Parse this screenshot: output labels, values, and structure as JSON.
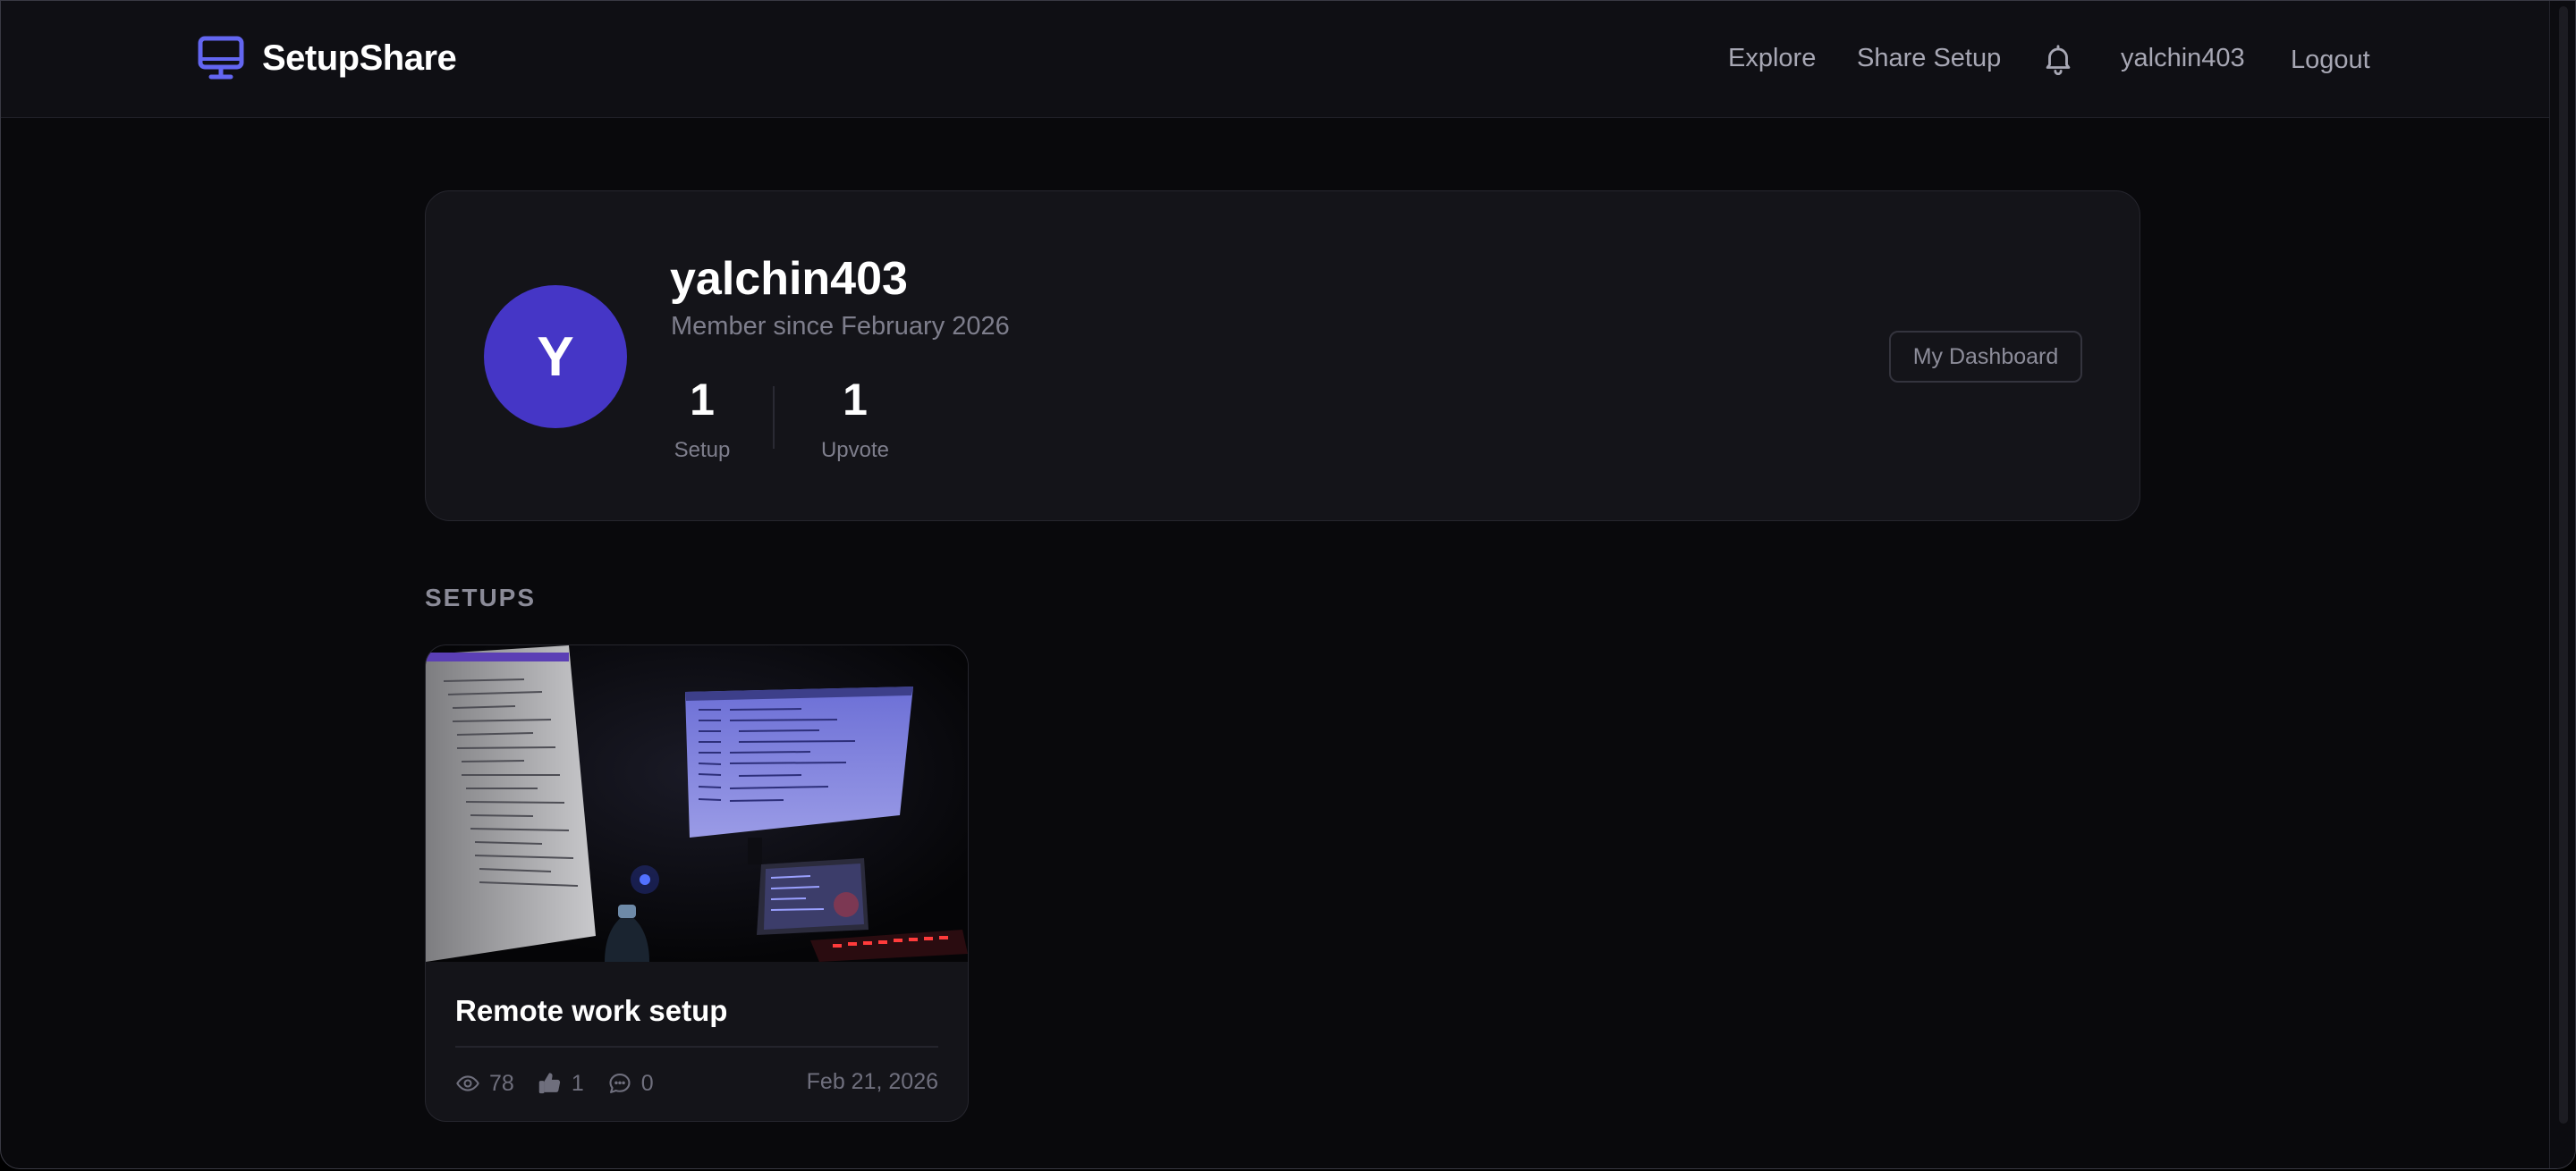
{
  "brand": {
    "name": "SetupShare",
    "icon": "monitor-icon",
    "accent": "#6366f1"
  },
  "nav": {
    "explore": "Explore",
    "share_setup": "Share Setup",
    "notifications_icon": "bell-icon",
    "username": "yalchin403",
    "logout": "Logout"
  },
  "profile": {
    "avatar_initial": "Y",
    "avatar_color": "#4536c6",
    "username": "yalchin403",
    "member_since": "Member since February 2026",
    "stats": [
      {
        "value": "1",
        "label": "Setup"
      },
      {
        "value": "1",
        "label": "Upvote"
      }
    ],
    "dashboard_button": "My Dashboard"
  },
  "setups_section": {
    "title": "SETUPS",
    "items": [
      {
        "title": "Remote work setup",
        "views": "78",
        "upvotes": "1",
        "comments": "0",
        "date": "Feb 21, 2026"
      }
    ]
  }
}
